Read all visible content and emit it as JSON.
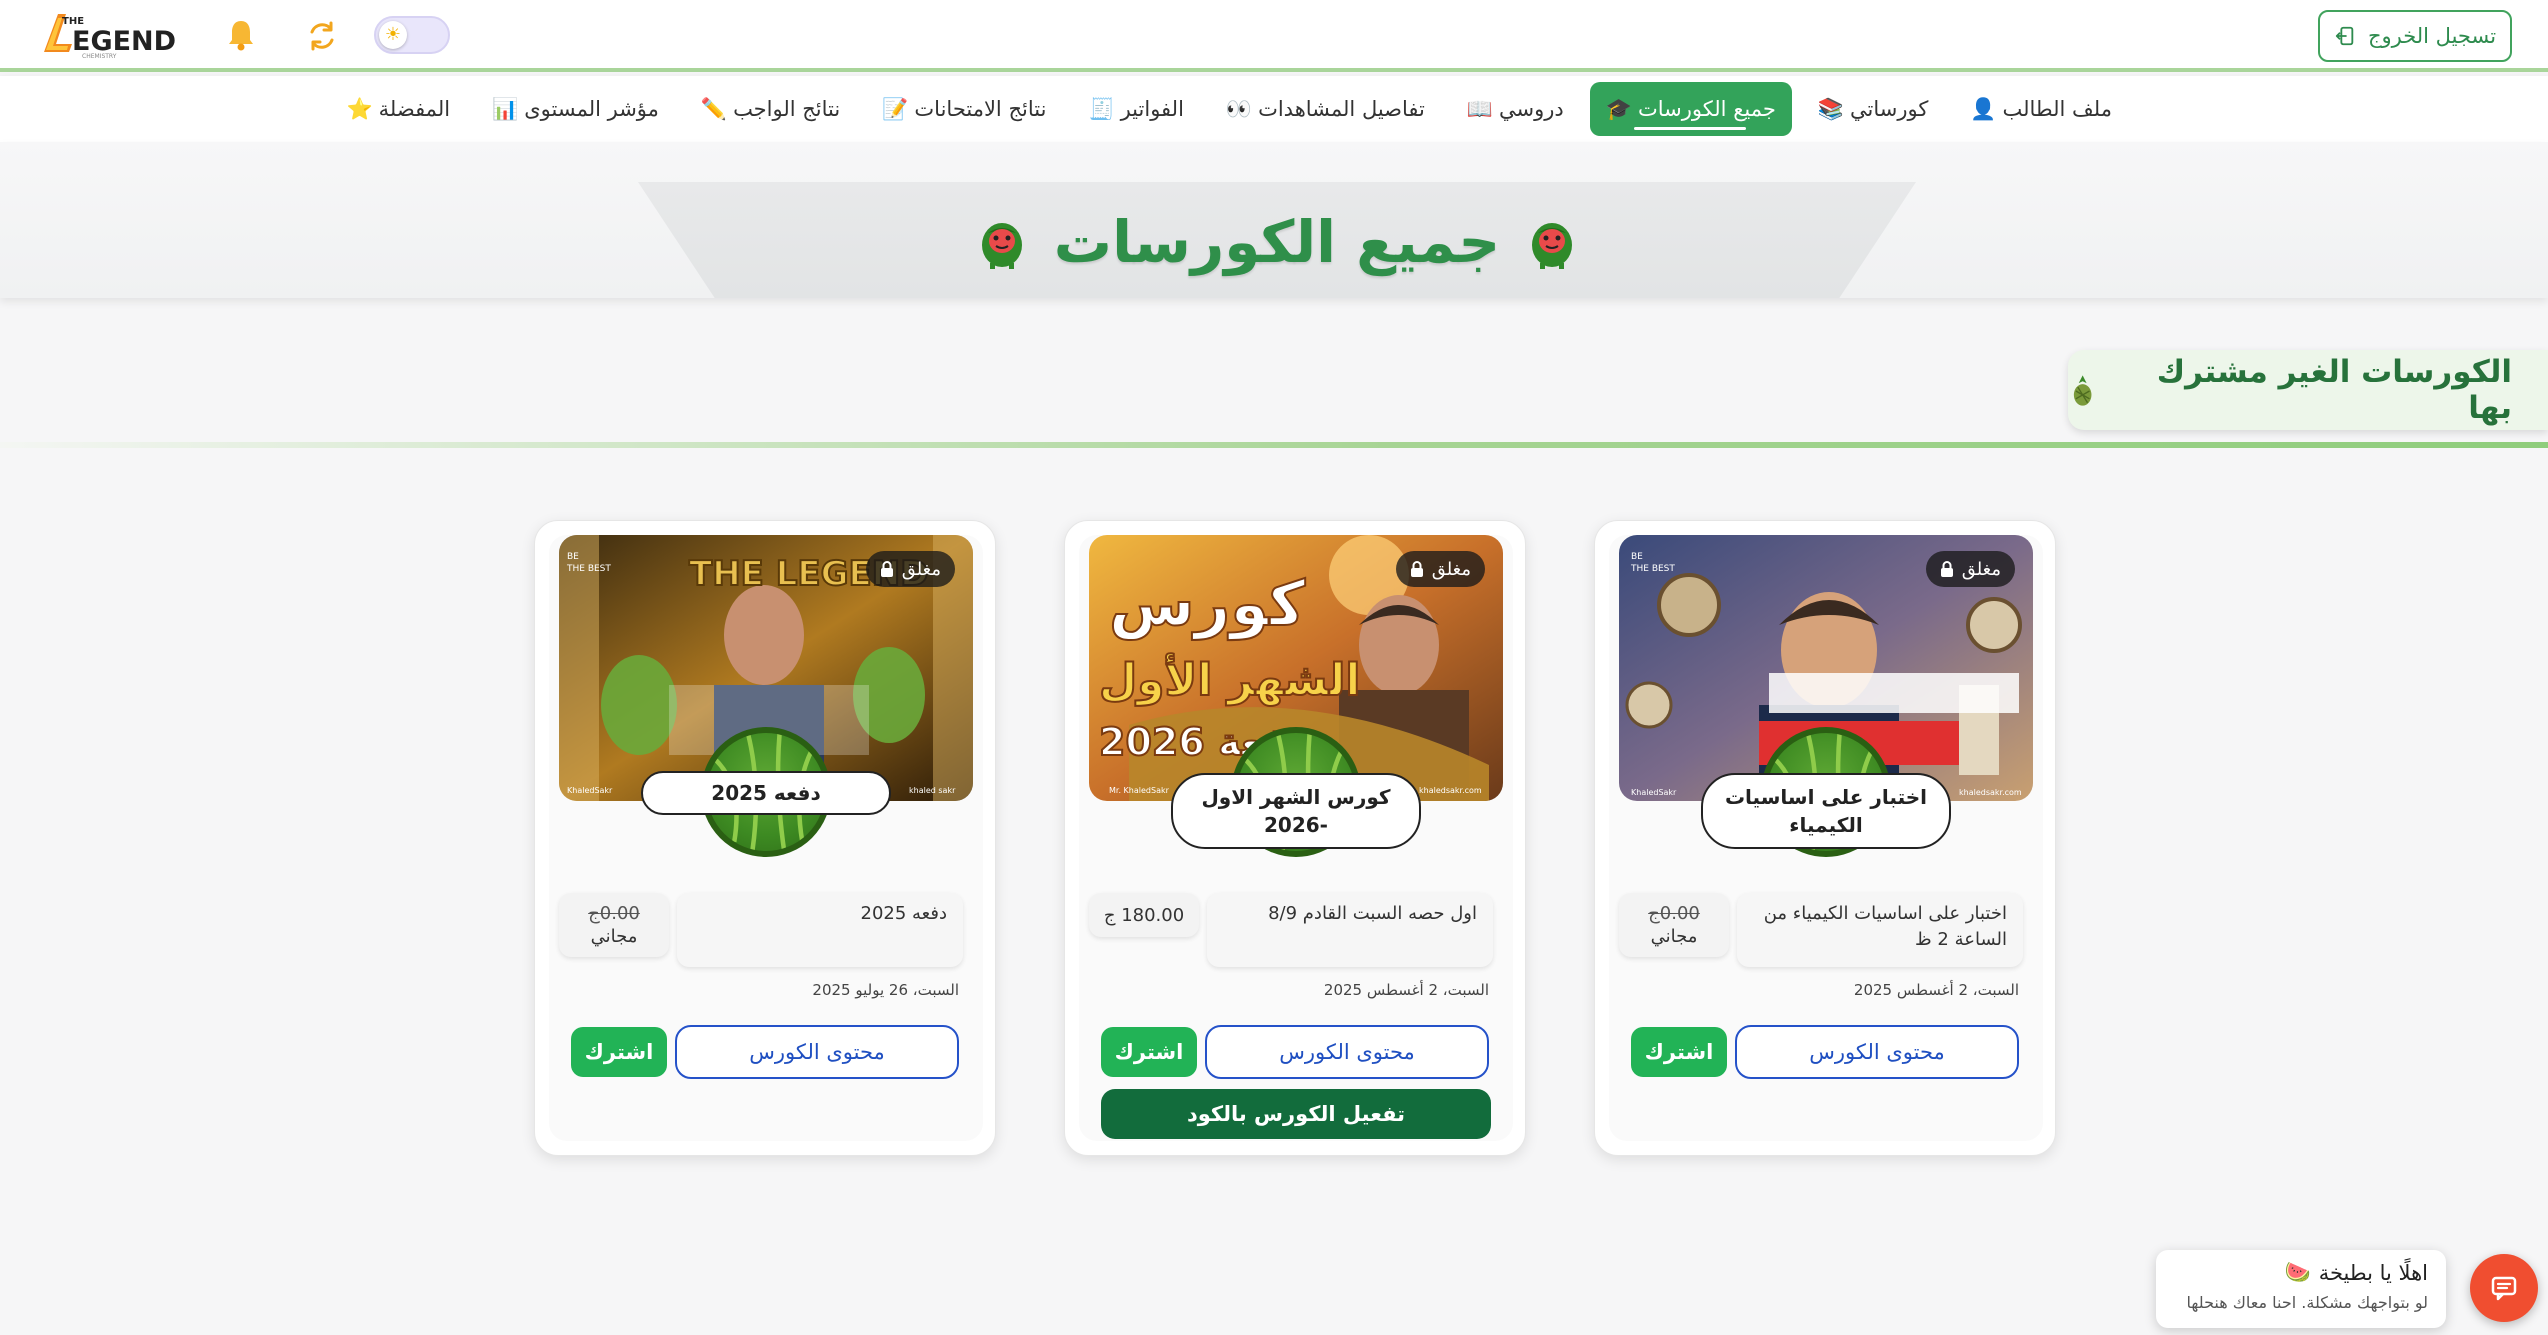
{
  "header": {
    "logo_text": "THE LEGEND",
    "logout_label": "تسجيل الخروج",
    "logout_icon": "logout-icon",
    "bell_icon": "bell-icon",
    "refresh_icon": "refresh-icon",
    "theme_toggle_icon": "sun-icon"
  },
  "nav": {
    "items": [
      {
        "label": "ملف الطالب",
        "emoji": "👤",
        "active": false
      },
      {
        "label": "كورساتي",
        "emoji": "📚",
        "active": false
      },
      {
        "label": "جميع الكورسات",
        "emoji": "🎓",
        "active": true
      },
      {
        "label": "دروسي",
        "emoji": "📖",
        "active": false
      },
      {
        "label": "تفاصيل المشاهدات",
        "emoji": "👀",
        "active": false
      },
      {
        "label": "الفواتير",
        "emoji": "🧾",
        "active": false
      },
      {
        "label": "نتائج الامتحانات",
        "emoji": "📝",
        "active": false
      },
      {
        "label": "نتائج الواجب",
        "emoji": "✏️",
        "active": false
      },
      {
        "label": "مؤشر المستوى",
        "emoji": "📊",
        "active": false
      },
      {
        "label": "المفضلة",
        "emoji": "⭐",
        "active": false
      }
    ]
  },
  "page": {
    "title": "جميع الكورسات",
    "section_title": "الكورسات الغير مشترك بها"
  },
  "courses": [
    {
      "status": "مغلق",
      "title": "اختبار على اساسيات الكيمياء",
      "description": "اختبار على اساسيات الكيمياء من الساعة 2 ظ",
      "price_old": "0.00ج",
      "price_label": "مجاني",
      "date": "السبت، 2 أغسطس 2025",
      "content_button": "محتوى الكورس",
      "subscribe_button": "اشترك",
      "activate_button": null,
      "thumb_text": "اساسيات الكيمياء"
    },
    {
      "status": "مغلق",
      "title": "كورس الشهر الاول -2026",
      "description": "اول حصه السبت القادم 8/9",
      "price_old": null,
      "price_label": "180.00 ج",
      "date": "السبت، 2 أغسطس 2025",
      "content_button": "محتوى الكورس",
      "subscribe_button": "اشترك",
      "activate_button": "تفعيل الكورس بالكود",
      "thumb_text": "كورس الشهر الأول دفعة 2026"
    },
    {
      "status": "مغلق",
      "title": "دفعه 2025",
      "description": "دفعه 2025",
      "price_old": "0.00ج",
      "price_label": "مجاني",
      "date": "السبت، 26 يوليو 2025",
      "content_button": "محتوى الكورس",
      "subscribe_button": "اشترك",
      "activate_button": null,
      "thumb_text": "THE LEGEND"
    }
  ],
  "chat": {
    "greeting": "اهلًا يا بطيخة",
    "greeting_emoji": "🍉",
    "subtext": "لو بتواجهك مشكلة. احنا معاك هنحلها",
    "icon": "chat-icon"
  },
  "colors": {
    "primary_green": "#33a35a",
    "dark_green": "#126c3c",
    "blue": "#2552c9",
    "chat_orange": "#f04e30"
  }
}
